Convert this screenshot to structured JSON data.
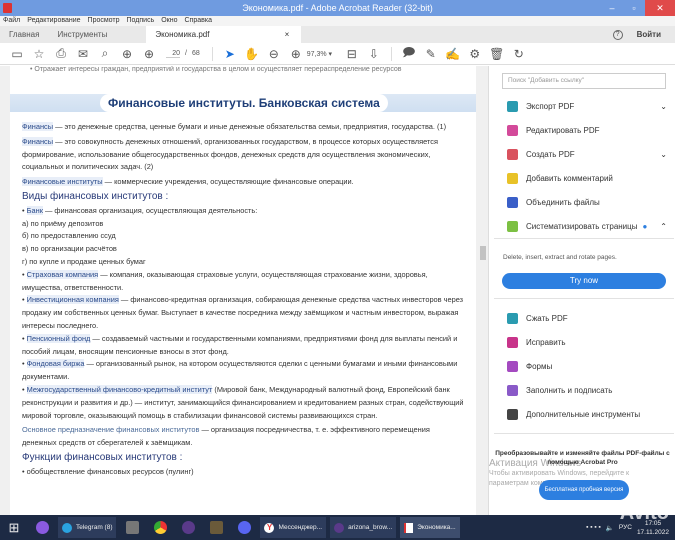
{
  "window": {
    "title": "Экономика.pdf - Adobe Acrobat Reader (32-bit)",
    "minimize": "–",
    "maximize": "▫",
    "close": "✕"
  },
  "menu": [
    "Файл",
    "Редактирование",
    "Просмотр",
    "Подпись",
    "Окно",
    "Справка"
  ],
  "tabs": {
    "home": "Главная",
    "tools": "Инструменты",
    "doc": "Экономика.pdf",
    "close": "×",
    "help": "?",
    "signin": "Войти"
  },
  "toolbar": {
    "page_current": "20",
    "page_sep": "/",
    "page_total": "68",
    "zoom": "97,3%"
  },
  "document": {
    "top_line": "• Отражает интересы граждан, предприятий и государства в целом и осуществляет перераспределение ресурсов",
    "heading": "Финансовые институты. Банковская система",
    "p1_term": "Финансы",
    "p1": " — это денежные средства, ценные бумаги и иные денежные обязательства семьи, предприятия, государства. (1)",
    "p2_term": "Финансы",
    "p2": " — это совокупность денежных отношений, организованных государством, в процессе которых осуществляется формирование, использование общегосударственных фондов, денежных средств для осуществления экономических, социальных и политических задач. (2)",
    "p3_term": "Финансовые институты",
    "p3": " — коммерческие учреждения, осуществляющие финансовые операции.",
    "h2": "Виды финансовых институтов :",
    "bank_term": "Банк",
    "bank": " — финансовая организация, осуществляющая деятельность:",
    "bank_items": [
      "а) по приёму депозитов",
      "б) по предоставлению ссуд",
      "в) по организации расчётов",
      "г) по купле и продаже ценных бумаг"
    ],
    "ins_term": "Страховая компания",
    "ins": " — компания, оказывающая страховые услуги, осуществляющая страхование жизни, здоровья, имущества, ответственности.",
    "inv_term": "Инвестиционная компания",
    "inv": " — финансово-кредитная организация, собирающая денежные средства частных инвесторов через продажу им собственных ценных бумаг. Выступает в качестве посредника между заёмщиком и частным инвестором, выражая интересы последнего.",
    "pen_term": "Пенсионный фонд",
    "pen": " — создаваемый частными и государственными компаниями, предприятиями фонд для выплаты пенсий и пособий лицам, вносящим пенсионные взносы в этот фонд.",
    "exch_term": "Фондовая биржа",
    "exch": " — организованный рынок, на котором осуществляются сделки с ценными бумагами и иными финансовыми документами.",
    "inter_term": "Межгосударственный финансово-кредитный институт",
    "inter": " (Мировой банк, Международный валютный фонд, Европейский банк реконструкции и развития и др.) — институт, занимающийся финансированием и кредитованием разных стран, содействующий мировой торговле, оказывающий помощь в стабилизации финансовой системы развивающихся стран.",
    "purpose_term": "Основное предназначение финансовых институтов",
    "purpose": " — организация посредничества, т. е. эффективного перемещения денежных средств от сберегателей к заёмщикам.",
    "h3": "Функции финансовых институтов :",
    "last_line": "• обобществление финансовых ресурсов (пулинг)"
  },
  "panel": {
    "search_placeholder": "Поиск \"Добавить ссылку\"",
    "tools": [
      {
        "label": "Экспорт PDF",
        "color": "#2a9bb0"
      },
      {
        "label": "Редактировать PDF",
        "color": "#d34a9a"
      },
      {
        "label": "Создать PDF",
        "color": "#d9525e"
      },
      {
        "label": "Добавить комментарий",
        "color": "#e8c228"
      },
      {
        "label": "Объединить файлы",
        "color": "#3a5fc8"
      },
      {
        "label": "Систематизировать страницы",
        "color": "#7cc043"
      }
    ],
    "organize_desc": "Delete, insert, extract and rotate pages.",
    "try_now": "Try now",
    "tools2": [
      {
        "label": "Сжать PDF",
        "color": "#2a9bb0"
      },
      {
        "label": "Исправить",
        "color": "#c8348a"
      },
      {
        "label": "Формы",
        "color": "#a44ac0"
      },
      {
        "label": "Заполнить и подписать",
        "color": "#8a5ac8"
      },
      {
        "label": "Дополнительные инструменты",
        "color": "#444444"
      }
    ],
    "promo": "Преобразовывайте и изменяйте файлы PDF-файлы с помощью Acrobat Pro",
    "trial": "Бесплатная пробная версия",
    "activation_title": "Активация Windows",
    "activation_text1": "Чтобы активировать Windows, перейдите к",
    "activation_text2": "параметрам компьютера."
  },
  "taskbar": {
    "telegram": "Telegram (8)",
    "yandex": "Мессенджер...",
    "arizona": "arizona_brow...",
    "acrobat": "Экономика...",
    "lang": "РУС",
    "time": "17:05",
    "date": "17.11.2022"
  },
  "watermark": "Avito"
}
